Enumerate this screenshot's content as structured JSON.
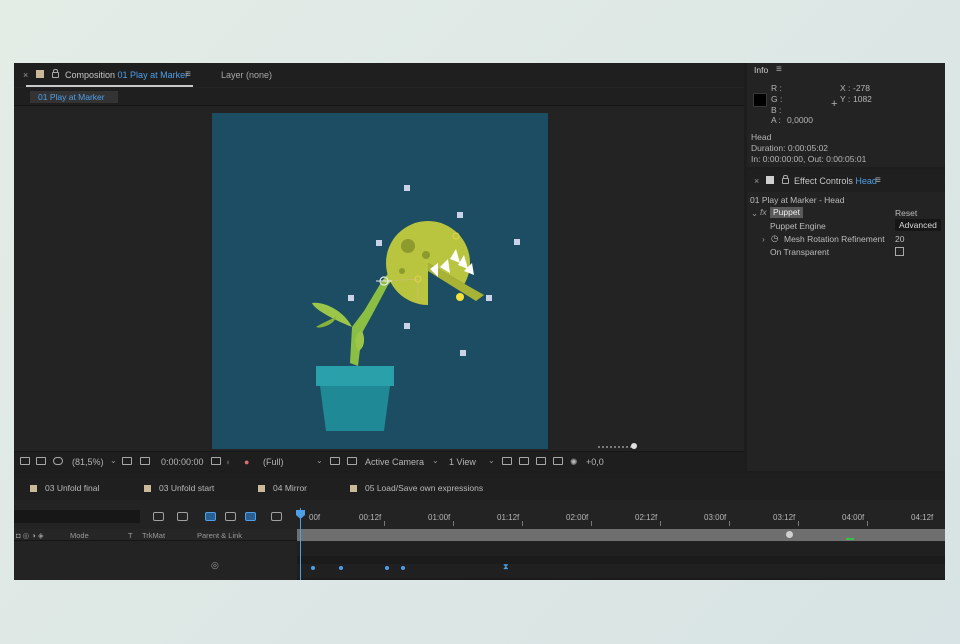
{
  "comp_panel": {
    "close_label": "×",
    "tab_prefix": "Composition",
    "comp_name": "01 Play at Marker",
    "menu_label": "≡",
    "layer_tab": "Layer (none)",
    "subtab": "01 Play at Marker"
  },
  "viewer_toolbar": {
    "zoom": "(81,5%)",
    "timecode": "0:00:00:00",
    "resolution": "(Full)",
    "camera": "Active Camera",
    "views": "1 View",
    "exposure": "+0,0"
  },
  "info_panel": {
    "title": "Info",
    "menu_label": "≡",
    "r_label": "R :",
    "g_label": "G :",
    "b_label": "B :",
    "a_label": "A :",
    "a_value": "0,0000",
    "x_label": "X :",
    "x_value": "-278",
    "y_label": "Y :",
    "y_value": "1082",
    "crosshair": "+",
    "layer_name": "Head",
    "duration": "Duration: 0:00:05:02",
    "in_out": "In: 0:00:00:00, Out: 0:00:05:01"
  },
  "effect_panel": {
    "close_label": "×",
    "title_prefix": "Effect Controls",
    "layer": "Head",
    "menu_label": "≡",
    "path": "01 Play at Marker - Head",
    "fx_label": "fx",
    "effect_name": "Puppet",
    "reset_label": "Reset",
    "engine_label": "Puppet Engine",
    "engine_value": "Advanced",
    "mesh_label": "Mesh Rotation Refinement",
    "mesh_value": "20",
    "transparent_label": "On Transparent"
  },
  "timeline": {
    "tabs": [
      "03 Unfold final",
      "03 Unfold start",
      "04 Mirror",
      "05 Load/Save own expressions"
    ],
    "ruler": [
      "00f",
      "00:12f",
      "01:00f",
      "01:12f",
      "02:00f",
      "02:12f",
      "03:00f",
      "03:12f",
      "04:00f",
      "04:12f"
    ],
    "columns": {
      "mode": "Mode",
      "t": "T",
      "trkmat": "TrkMat",
      "parent": "Parent & Link"
    }
  },
  "colors": {
    "accent": "#4d9fe8",
    "canvas": "#1d4d63",
    "plant_head": "#b9c43f",
    "pot": "#1f8a96"
  }
}
